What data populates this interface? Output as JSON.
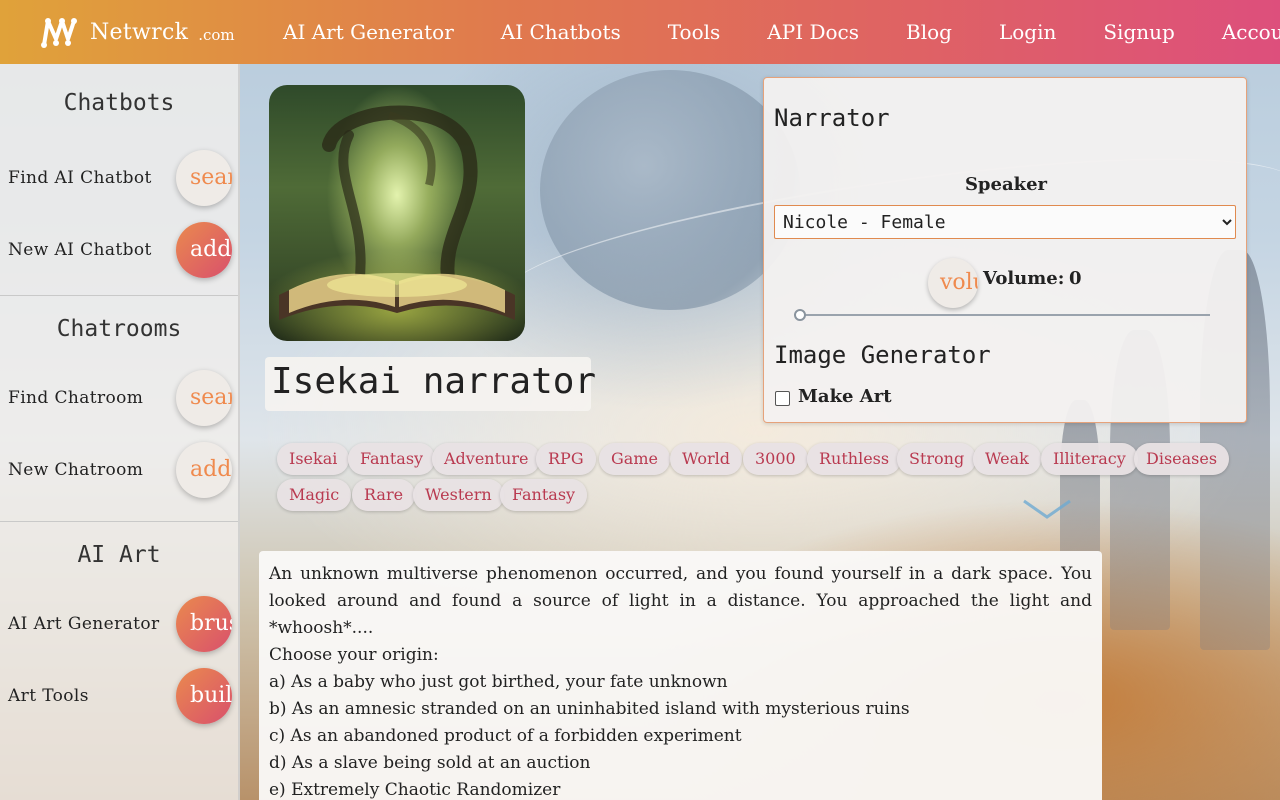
{
  "nav": {
    "brand": "Netwrck",
    "tld": ".com",
    "items": [
      "AI Art Generator",
      "AI Chatbots",
      "Tools",
      "API Docs",
      "Blog",
      "Login",
      "Signup",
      "Account"
    ]
  },
  "sidebar": {
    "sections": [
      {
        "title": "Chatbots",
        "rows": [
          {
            "label": "Find AI Chatbot",
            "button": "search"
          },
          {
            "label": "New AI Chatbot",
            "button": "add"
          }
        ]
      },
      {
        "title": "Chatrooms",
        "rows": [
          {
            "label": "Find Chatroom",
            "button": "search"
          },
          {
            "label": "New Chatroom",
            "button": "add"
          }
        ]
      },
      {
        "title": "AI Art",
        "rows": [
          {
            "label": "AI Art Generator",
            "button": "brush"
          },
          {
            "label": "Art Tools",
            "button": "build"
          }
        ]
      }
    ]
  },
  "bot": {
    "title": "Isekai narrator",
    "tags": [
      "Isekai",
      "Fantasy",
      "Adventure",
      "RPG",
      "Game",
      "World",
      "3000",
      "Ruthless",
      "Strong",
      "Weak",
      "Illiteracy",
      "Diseases",
      "Magic",
      "Rare",
      "Western",
      "Fantasy"
    ]
  },
  "narrator": {
    "title": "Narrator",
    "speaker_label": "Speaker",
    "speaker_selected": "Nicole - Female",
    "volume_button": "volume_up",
    "volume_label": "Volume:",
    "volume_value": "0",
    "volume_level": 0,
    "image_gen_title": "Image Generator",
    "make_art_label": "Make Art",
    "make_art_checked": false
  },
  "story": {
    "lines": [
      "An unknown multiverse phenomenon occurred, and you found yourself in a dark space. You looked around and found a source of light in a distance. You approached the light and *whoosh*....",
      "Choose your origin:",
      "a) As a baby who just got birthed, your fate unknown",
      "b) As an amnesic stranded on an uninhabited island with mysterious ruins",
      "c) As an abandoned product of a forbidden experiment",
      "d) As a slave being sold at an auction",
      "e) Extremely Chaotic Randomizer"
    ]
  },
  "colors": {
    "accent_orange": "#ef8a4e",
    "accent_pink": "#d9506c",
    "tag_text": "#b93a50"
  }
}
